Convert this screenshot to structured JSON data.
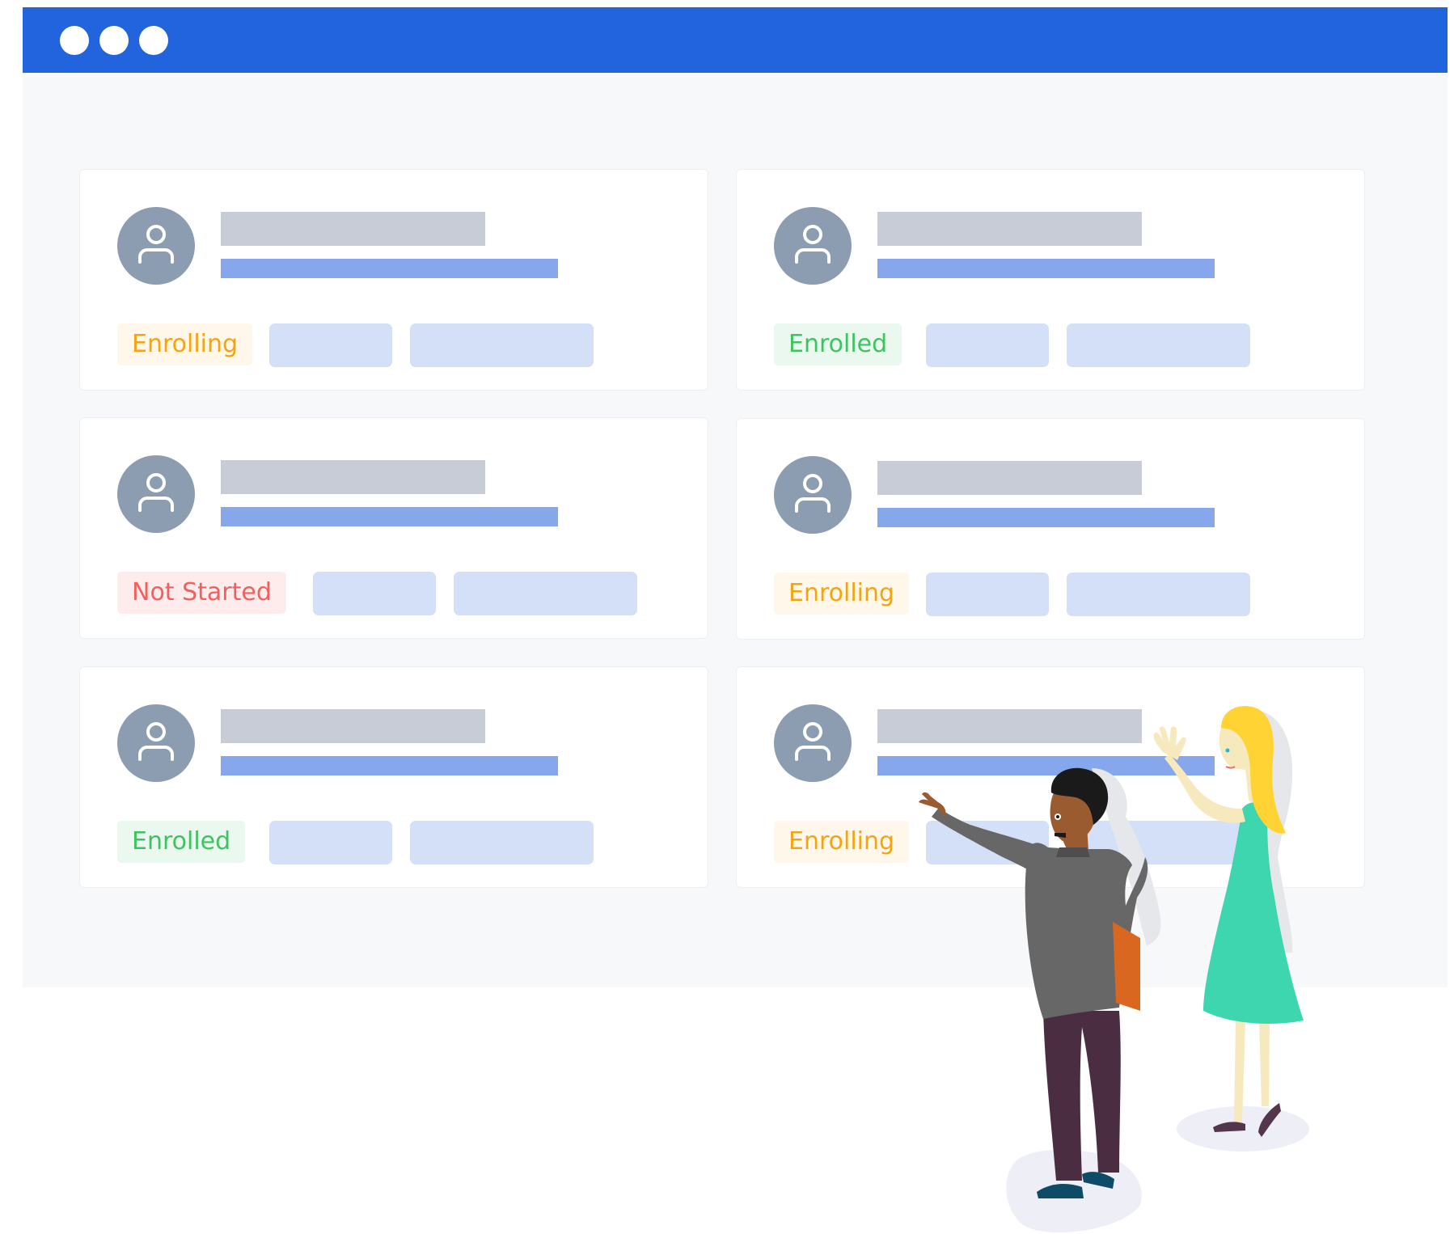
{
  "window": {
    "controls": [
      "window-dot-1",
      "window-dot-2",
      "window-dot-3"
    ]
  },
  "cards": [
    {
      "status": "Enrolling",
      "status_kind": "enrolling",
      "avatar_icon": "user-icon"
    },
    {
      "status": "Enrolled",
      "status_kind": "enrolled",
      "avatar_icon": "user-icon"
    },
    {
      "status": "Not Started",
      "status_kind": "notstarted",
      "avatar_icon": "user-icon"
    },
    {
      "status": "Enrolling",
      "status_kind": "enrolling",
      "avatar_icon": "user-icon"
    },
    {
      "status": "Enrolled",
      "status_kind": "enrolled",
      "avatar_icon": "user-icon"
    },
    {
      "status": "Enrolling",
      "status_kind": "enrolling",
      "avatar_icon": "user-icon"
    }
  ],
  "colors": {
    "titlebar": "#2164de",
    "avatar": "#8c9cb1",
    "name_placeholder": "#c8ccd6",
    "sub_placeholder": "#87a7ec",
    "pill": "#d4e0f7",
    "enrolling_text": "#f2a413",
    "enrolled_text": "#3fc361",
    "not_started_text": "#f0605f"
  }
}
